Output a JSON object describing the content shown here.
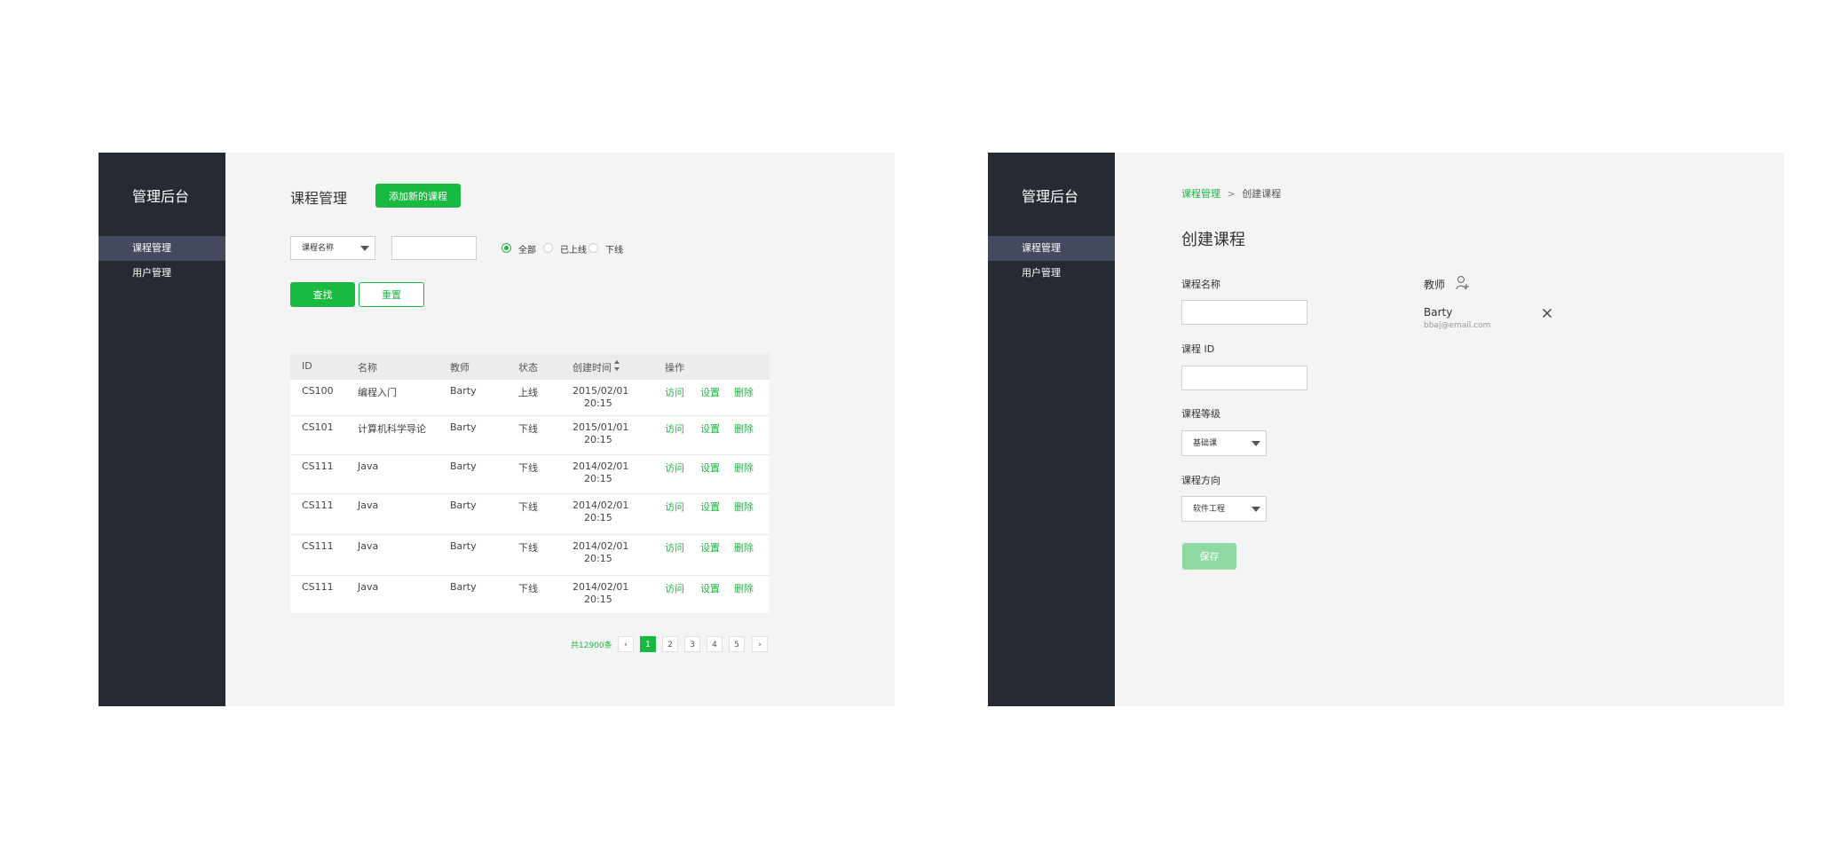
{
  "left": {
    "brand": "管理后台",
    "nav": [
      "课程管理",
      "用户管理"
    ],
    "page_title": "课程管理",
    "add_button": "添加新的课程",
    "filter": {
      "select_value": "课程名称",
      "radios": [
        "全部",
        "已上线",
        "下线"
      ],
      "selected_radio": "全部"
    },
    "search_button": "查找",
    "reset_button": "重置",
    "table": {
      "headers": [
        "ID",
        "名称",
        "教师",
        "状态",
        "创建时间",
        "操作"
      ],
      "rows": [
        {
          "id": "CS100",
          "name": "编程入门",
          "teacher": "Barty",
          "status": "上线",
          "date": "2015/02/01",
          "time": "20:15"
        },
        {
          "id": "CS101",
          "name": "计算机科学导论",
          "teacher": "Barty",
          "status": "下线",
          "date": "2015/01/01",
          "time": "20:15"
        },
        {
          "id": "CS111",
          "name": "Java",
          "teacher": "Barty",
          "status": "下线",
          "date": "2014/02/01",
          "time": "20:15"
        },
        {
          "id": "CS111",
          "name": "Java",
          "teacher": "Barty",
          "status": "下线",
          "date": "2014/02/01",
          "time": "20:15"
        },
        {
          "id": "CS111",
          "name": "Java",
          "teacher": "Barty",
          "status": "下线",
          "date": "2014/02/01",
          "time": "20:15"
        },
        {
          "id": "CS111",
          "name": "Java",
          "teacher": "Barty",
          "status": "下线",
          "date": "2014/02/01",
          "time": "20:15"
        }
      ],
      "actions": [
        "访问",
        "设置",
        "删除"
      ]
    },
    "pagination": {
      "total": "共12900条",
      "prev": "‹",
      "next": "›",
      "pages": [
        "1",
        "2",
        "3",
        "4",
        "5"
      ],
      "current": "1"
    }
  },
  "right": {
    "brand": "管理后台",
    "nav": [
      "课程管理",
      "用户管理"
    ],
    "breadcrumb": {
      "parent": "课程管理",
      "separator": ">",
      "current": "创建课程"
    },
    "page_title": "创建课程",
    "fields": {
      "name_label": "课程名称",
      "id_label": "课程 ID",
      "level_label": "课程等级",
      "level_value": "基础课",
      "direction_label": "课程方向",
      "direction_value": "软件工程"
    },
    "teacher": {
      "label": "教师",
      "name": "Barty",
      "email": "bbaj@email.com"
    },
    "save_button": "保存"
  },
  "colors": {
    "accent": "#19b941",
    "sidebar": "#262a33",
    "sidebar_active": "#454a5f",
    "content_bg": "#f4f4f4",
    "save_disabled": "#8fd9a3"
  },
  "icons": {
    "sort": "sort-arrows-icon",
    "add_user": "user-plus-icon",
    "remove": "close-icon",
    "dropdown": "caret-down-icon"
  }
}
